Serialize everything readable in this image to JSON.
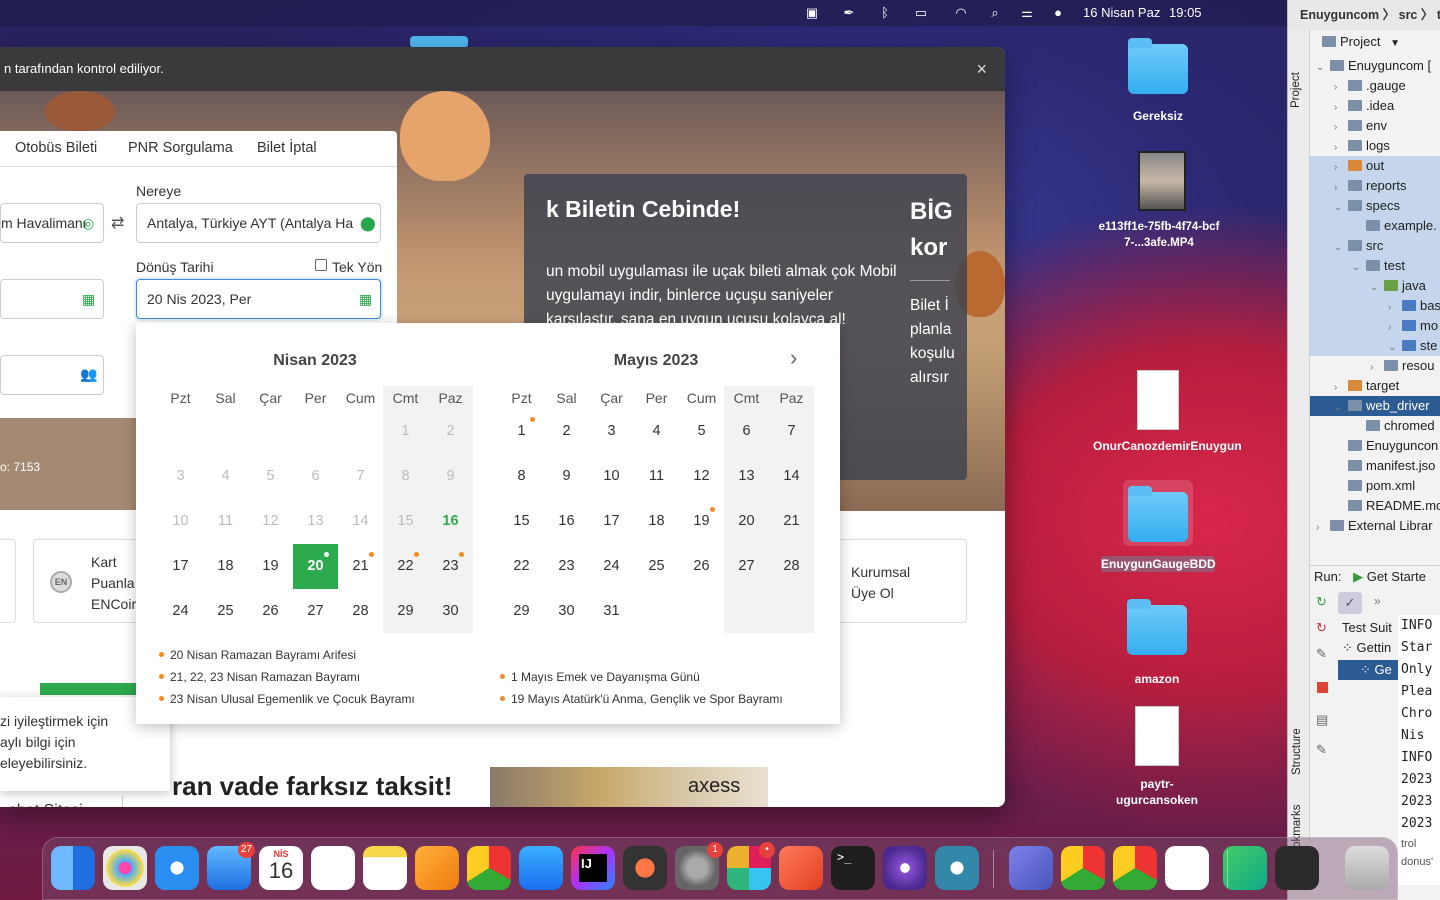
{
  "menubar": {
    "date": "16 Nisan Paz",
    "time": "19:05"
  },
  "browser": {
    "infobar_text": "n tarafından kontrol ediliyor.",
    "close": "×",
    "tabs": [
      "Otobüs Bileti",
      "PNR Sorgulama",
      "Bilet İptal"
    ],
    "from_value": "m Havalimanı",
    "to_label": "Nereye",
    "to_value": "Antalya, Türkiye AYT (Antalya Ha",
    "return_label": "Dönüş Tarihi",
    "oneway_label": "Tek Yön",
    "return_value": "20 Nis 2023, Per",
    "strip_text": "o: 7153",
    "promo": {
      "title": "k Biletin Cebinde!",
      "text": "un mobil uygulaması ile uçak bileti almak çok Mobil uygulamayı indir, binlerce uçuşu saniyeler karşılaştır, sana en uygun uçuşu kolayca al!",
      "right_title": "BİG kor",
      "right_text": "Bilet İ planla koşulu alırsır"
    },
    "card_ken": "Kart Puanla ENCoir",
    "card_ken_logo": "EN",
    "card_kurumsal": "Kurumsal Üye Ol",
    "cookie_text": "zi iyileştirmek için aylı bilgi için eleyebilirsiniz.",
    "banner_text": "ran vade farksız taksit!",
    "banner_brand": "axess",
    "footer_cut": "ebet Sitesi"
  },
  "calendar": {
    "months": [
      {
        "title": "Nisan 2023",
        "weekdays": [
          "Pzt",
          "Sal",
          "Çar",
          "Per",
          "Cum",
          "Cmt",
          "Paz"
        ],
        "weeks": [
          [
            "",
            "",
            "",
            "",
            "",
            "1",
            "2"
          ],
          [
            "3",
            "4",
            "5",
            "6",
            "7",
            "8",
            "9"
          ],
          [
            "10",
            "11",
            "12",
            "13",
            "14",
            "15",
            "16"
          ],
          [
            "17",
            "18",
            "19",
            "20",
            "21",
            "22",
            "23"
          ],
          [
            "24",
            "25",
            "26",
            "27",
            "28",
            "29",
            "30"
          ]
        ]
      },
      {
        "title": "Mayıs 2023",
        "weekdays": [
          "Pzt",
          "Sal",
          "Çar",
          "Per",
          "Cum",
          "Cmt",
          "Paz"
        ],
        "weeks": [
          [
            "1",
            "2",
            "3",
            "4",
            "5",
            "6",
            "7"
          ],
          [
            "8",
            "9",
            "10",
            "11",
            "12",
            "13",
            "14"
          ],
          [
            "15",
            "16",
            "17",
            "18",
            "19",
            "20",
            "21"
          ],
          [
            "22",
            "23",
            "24",
            "25",
            "26",
            "27",
            "28"
          ],
          [
            "29",
            "30",
            "31",
            "",
            "",
            "",
            ""
          ]
        ]
      }
    ],
    "today": "16",
    "selected": "20",
    "holidays_left": [
      "20 Nisan Ramazan Bayramı Arifesi",
      "21, 22, 23 Nisan Ramazan Bayramı",
      "23 Nisan Ulusal Egemenlik ve Çocuk Bayramı"
    ],
    "holidays_right": [
      "1 Mayıs Emek ve Dayanışma Günü",
      "19 Mayıs Atatürk'ü Anma, Gençlik ve Spor Bayramı"
    ],
    "next_icon": "chevron-right-icon"
  },
  "desktop": {
    "icons": [
      "Gereksiz",
      "e113ff1e-75fb-4f74-bcf7-...3afe.MP4",
      "OnurCanozdemirEnuygun",
      "EnuygunGaugeBDD",
      "amazon",
      "paytr-ugurcansoken"
    ]
  },
  "ide": {
    "breadcrumb": "Enuyguncom 〉 src 〉 tes",
    "panel_title": "Project",
    "side_project": "Project",
    "side_structure": "Structure",
    "side_bookmarks": "Bookmarks",
    "tree": [
      "Enuyguncom [",
      ".gauge",
      ".idea",
      "env",
      "logs",
      "out",
      "reports",
      "specs",
      "example.",
      "src",
      "test",
      "java",
      "bas",
      "mo",
      "ste",
      "resou",
      "target",
      "web_driver",
      "chromed",
      "Enuyguncon",
      "manifest.jso",
      "pom.xml",
      "README.mc",
      "External Librar"
    ],
    "run_label": "Run:",
    "run_config": "Get Starte",
    "run_tree": [
      "Test Suit",
      "Gettin",
      "Ge"
    ],
    "console": [
      "INFO",
      "Star",
      "Only",
      "Plea",
      "Chro",
      "Nis",
      "INFO",
      "2023",
      "2023",
      "2023",
      "trol",
      "donus'"
    ]
  },
  "dock": {
    "badges": {
      "mail": "27",
      "settings": "1",
      "slack": "•"
    },
    "calendar_month": "NİS",
    "calendar_day": "16"
  }
}
